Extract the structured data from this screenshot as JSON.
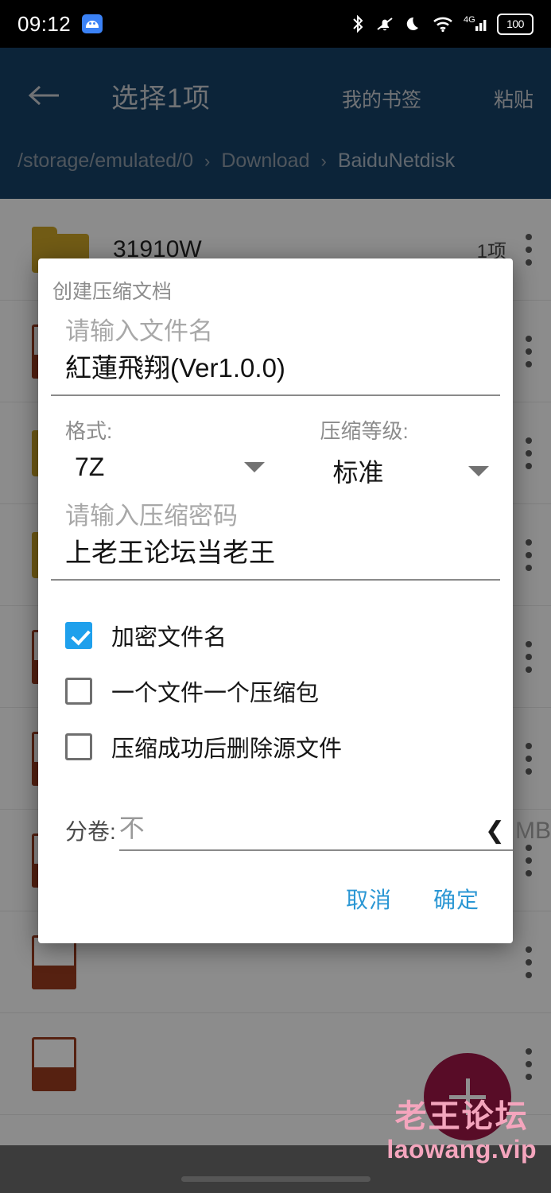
{
  "statusbar": {
    "time": "09:12",
    "icons": [
      "android-icon",
      "bluetooth-icon",
      "mute-bell-icon",
      "moon-icon",
      "wifi-icon",
      "signal-4g-icon",
      "battery-icon"
    ],
    "network_label": "4G",
    "battery_level": "100"
  },
  "appbar": {
    "back_icon": "back-arrow-icon",
    "title": "选择1项",
    "action_bookmarks": "我的书签",
    "action_paste": "粘贴",
    "breadcrumb": [
      "/storage/emulated/0",
      "Download",
      "BaiduNetdisk"
    ],
    "separator": "›",
    "bg_color": "#174066"
  },
  "filelist": {
    "rows": [
      {
        "icon": "folder-icon",
        "name": "31910W",
        "meta": "1项"
      },
      {
        "icon": "file-icon",
        "name": "",
        "meta": ""
      },
      {
        "icon": "folder-icon",
        "name": "",
        "meta": ""
      },
      {
        "icon": "folder-icon",
        "name": "",
        "meta": ""
      },
      {
        "icon": "file-icon",
        "name": "",
        "meta": ""
      },
      {
        "icon": "file-icon",
        "name": "",
        "meta": ""
      },
      {
        "icon": "file-icon",
        "name": "",
        "meta": ""
      },
      {
        "icon": "file-icon",
        "name": "",
        "meta": ""
      },
      {
        "icon": "file-icon",
        "name": "",
        "meta": ""
      }
    ],
    "kebab_icon": "more-vertical-icon"
  },
  "fab": {
    "icon": "plus-icon",
    "color": "#9e1646"
  },
  "watermark": {
    "cn": "老王论坛",
    "en": "laowang.vip",
    "color": "#f4a5bd"
  },
  "dialog": {
    "title": "创建压缩文档",
    "filename": {
      "placeholder": "请输入文件名",
      "value": "紅蓮飛翔(Ver1.0.0)"
    },
    "format": {
      "label": "格式:",
      "value": "7Z",
      "caret_icon": "chevron-down-icon"
    },
    "level": {
      "label": "压缩等级:",
      "value": "标准",
      "caret_icon": "chevron-down-icon"
    },
    "password": {
      "placeholder": "请输入压缩密码",
      "value": "上老王论坛当老王"
    },
    "checkboxes": [
      {
        "label": "加密文件名",
        "checked": true
      },
      {
        "label": "一个文件一个压缩包",
        "checked": false
      },
      {
        "label": "压缩成功后删除源文件",
        "checked": false
      }
    ],
    "split": {
      "label": "分卷:",
      "value": "不",
      "chevron_icon": "chevron-left-icon",
      "chevron_glyph": "❮",
      "unit": "MB"
    },
    "buttons": {
      "cancel": "取消",
      "confirm": "确定"
    },
    "accent_color": "#2b97d4",
    "checkbox_color": "#1fa0ec"
  }
}
